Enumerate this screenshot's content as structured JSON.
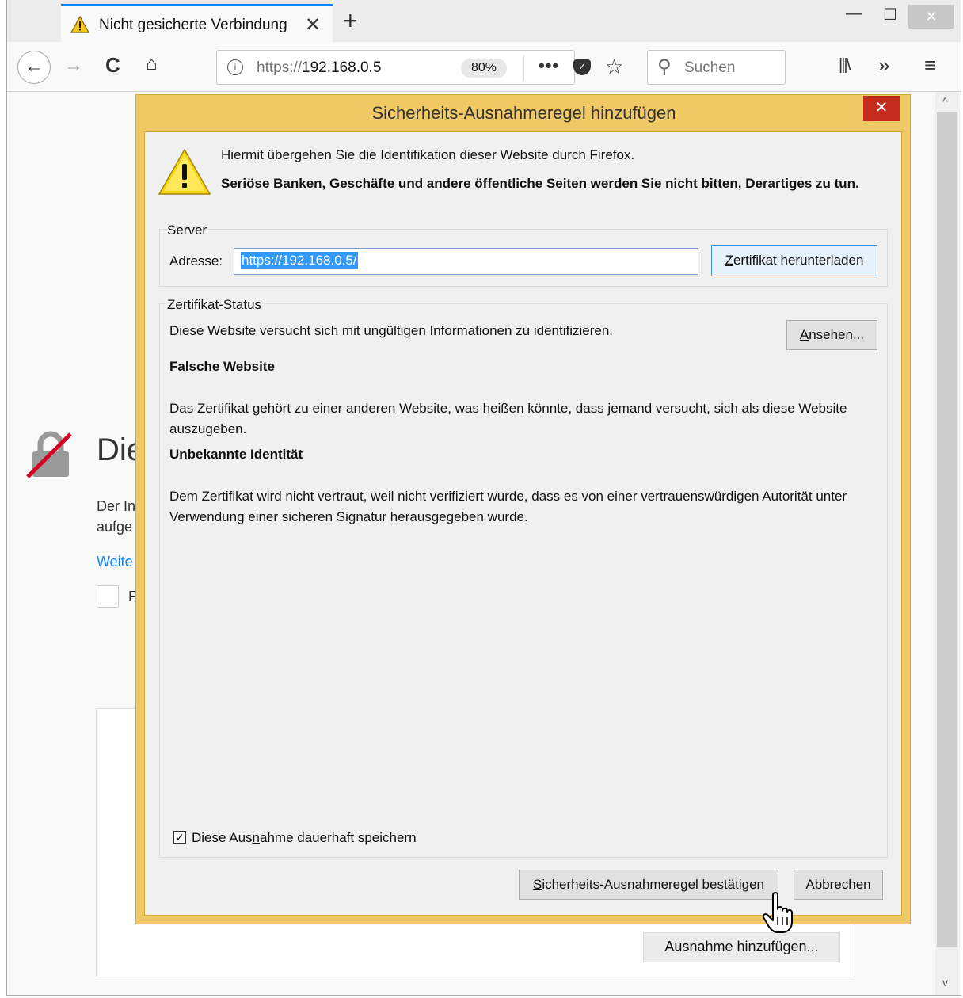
{
  "tab": {
    "title": "Nicht gesicherte Verbindung",
    "close_glyph": "✕",
    "new_tab_glyph": "+"
  },
  "window_controls": {
    "minimize": "—",
    "maximize": "☐",
    "close": "✕"
  },
  "navbar": {
    "back_glyph": "←",
    "forward_glyph": "→",
    "reload_glyph": "C",
    "home_glyph": "⌂",
    "url_prefix": "https://",
    "url_host": "192.168.0.5",
    "zoom": "80%",
    "more_glyph": "•••",
    "bookmark_glyph": "☆",
    "search_placeholder": "Suchen",
    "library_glyph": "|||\\",
    "overflow_glyph": "»",
    "menu_glyph": "≡"
  },
  "page": {
    "heading_fragment": "Die",
    "text_fragment_1": "Der In",
    "text_fragment_2": "aufge",
    "link_fragment": "Weite",
    "checkbox_label_fragment": "F",
    "add_exception_button": "Ausnahme hinzufügen..."
  },
  "dialog": {
    "title": "Sicherheits-Ausnahmeregel hinzufügen",
    "close_glyph": "✕",
    "intro_line": "Hiermit übergehen Sie die Identifikation dieser Website durch Firefox.",
    "intro_bold": "Seriöse Banken, Geschäfte und andere öffentliche Seiten werden Sie nicht bitten, Derartiges zu tun.",
    "server": {
      "legend": "Server",
      "address_label": "Adresse:",
      "address_value": "https://192.168.0.5/",
      "download_button": "Zertifikat herunterladen"
    },
    "status": {
      "legend": "Zertifikat-Status",
      "line": "Diese Website versucht sich mit ungültigen Informationen zu identifizieren.",
      "view_button": "Ansehen...",
      "wrong_title": "Falsche Website",
      "wrong_text": "Das Zertifikat gehört zu einer anderen Website, was heißen könnte, dass jemand versucht, sich als diese Website auszugeben.",
      "unknown_title": "Unbekannte Identität",
      "unknown_text": "Dem Zertifikat wird nicht vertraut, weil nicht verifiziert wurde, dass es von einer vertrauenswürdigen Autorität unter Verwendung einer sicheren Signatur herausgegeben wurde."
    },
    "persist_label": "Diese Ausnahme dauerhaft speichern",
    "persist_checked": true,
    "confirm_button": "Sicherheits-Ausnahmeregel bestätigen",
    "cancel_button": "Abbrechen"
  },
  "colors": {
    "dialog_frame": "#f0c965",
    "selection": "#3399ff",
    "link": "#0a84ff",
    "close_red": "#c42b1c"
  },
  "icons": [
    "warning-icon",
    "info-icon",
    "pocket-icon",
    "search-icon",
    "lock-broken-icon",
    "hand-cursor-icon"
  ]
}
